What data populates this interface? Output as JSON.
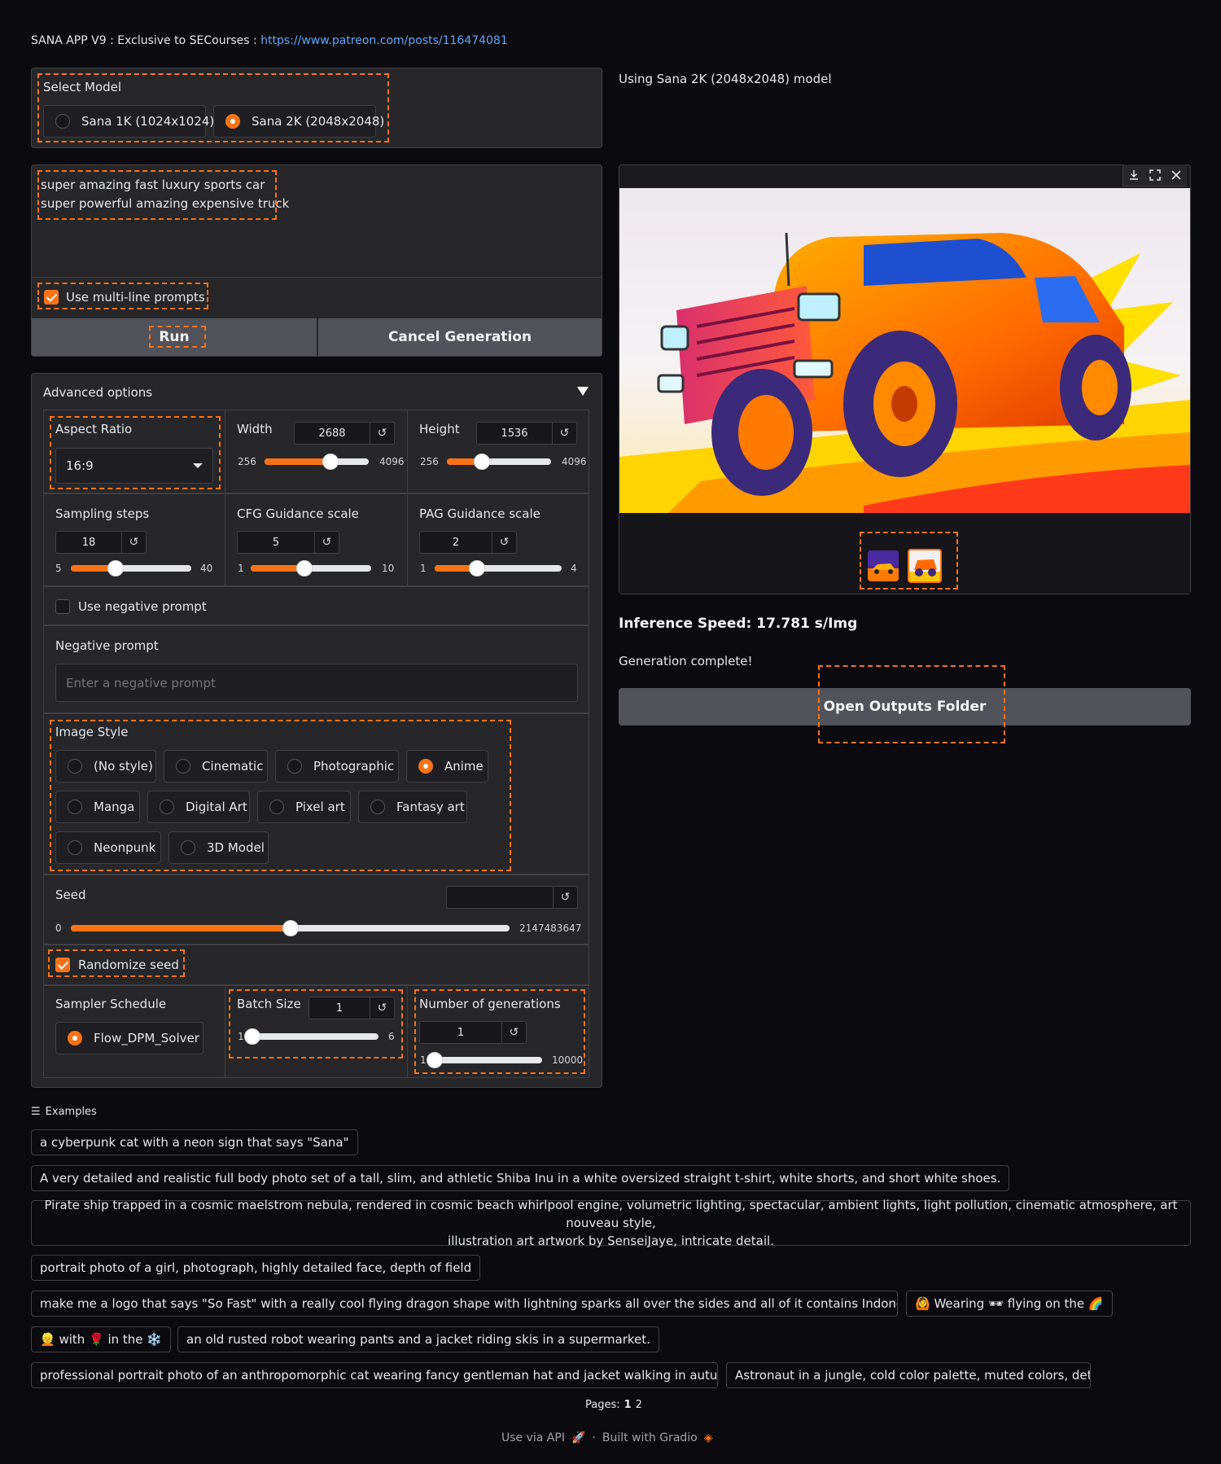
{
  "header": {
    "title": "SANA APP V9 : Exclusive to SECourses : ",
    "link": "https://www.patreon.com/posts/116474081"
  },
  "model_select": {
    "label": "Select Model",
    "options": [
      {
        "label": "Sana 1K (1024x1024)",
        "selected": false
      },
      {
        "label": "Sana 2K (2048x2048)",
        "selected": true
      }
    ],
    "status": "Using Sana 2K (2048x2048) model"
  },
  "prompt": {
    "line1": "super amazing fast luxury sports car",
    "line2": "super powerful amazing expensive truck"
  },
  "multiline": {
    "label": "Use multi-line prompts",
    "checked": true
  },
  "buttons": {
    "run": "Run",
    "cancel": "Cancel Generation",
    "open_outputs": "Open Outputs Folder"
  },
  "advanced": {
    "title": "Advanced options",
    "aspect_ratio": {
      "label": "Aspect Ratio",
      "value": "16:9"
    },
    "width": {
      "label": "Width",
      "value": "2688",
      "min": "256",
      "max": "4096",
      "fraction": 0.636
    },
    "height": {
      "label": "Height",
      "value": "1536",
      "min": "256",
      "max": "4096",
      "fraction": 0.333
    },
    "sampling_steps": {
      "label": "Sampling steps",
      "value": "18",
      "min": "5",
      "max": "40",
      "fraction": 0.371
    },
    "cfg": {
      "label": "CFG Guidance scale",
      "value": "5",
      "min": "1",
      "max": "10",
      "fraction": 0.444
    },
    "pag": {
      "label": "PAG Guidance scale",
      "value": "2",
      "min": "1",
      "max": "4",
      "fraction": 0.333
    },
    "negative_toggle": {
      "label": "Use negative prompt",
      "checked": false
    },
    "negative_prompt": {
      "label": "Negative prompt",
      "placeholder": "Enter a negative prompt"
    },
    "image_style": {
      "label": "Image Style",
      "options": [
        "(No style)",
        "Cinematic",
        "Photographic",
        "Anime",
        "Manga",
        "Digital Art",
        "Pixel art",
        "Fantasy art",
        "Neonpunk",
        "3D Model"
      ],
      "selected": "Anime"
    },
    "seed": {
      "label": "Seed",
      "value": "",
      "min": "0",
      "max": "2147483647",
      "fraction": 0.5
    },
    "randomize": {
      "label": "Randomize seed",
      "checked": true
    },
    "sampler": {
      "label": "Sampler Schedule",
      "option": "Flow_DPM_Solver"
    },
    "batch": {
      "label": "Batch Size",
      "value": "1",
      "min": "1",
      "max": "6",
      "fraction": 0.0
    },
    "generations": {
      "label": "Number of generations",
      "value": "1",
      "min": "1",
      "max": "10000",
      "fraction": 0.0
    }
  },
  "output": {
    "speed": "Inference Speed: 17.781 s/Img",
    "status": "Generation complete!"
  },
  "examples": {
    "header": "Examples",
    "items": [
      "a cyberpunk cat with a neon sign that says \"Sana\"",
      "A very detailed and realistic full body photo set of a tall, slim, and athletic Shiba Inu in a white oversized straight t-shirt, white shorts, and short white shoes.",
      "Pirate ship trapped in a cosmic maelstrom nebula, rendered in cosmic beach whirlpool engine, volumetric lighting, spectacular, ambient lights, light pollution, cinematic atmosphere, art nouveau style,",
      "illustration art artwork by SenseiJaye, intricate detail.",
      "portrait photo of a girl, photograph, highly detailed face, depth of field",
      "make me a logo that says \"So Fast\" with a really cool flying dragon shape with lightning sparks all over the sides and all of it contains Indonesian language",
      "🙆 Wearing 🕶 flying on the 🌈",
      "👱 with 🌹 in the ❄️",
      "an old rusted robot wearing pants and a jacket riding skis in a supermarket.",
      "professional portrait photo of an anthropomorphic cat wearing fancy gentleman hat and jacket walking in autumn forest.",
      "Astronaut in a jungle, cold color palette, muted colors, detailed"
    ],
    "pages_label": "Pages:",
    "pages": [
      "1",
      "2"
    ]
  },
  "footer": {
    "api": "Use via API",
    "built": "Built with Gradio"
  }
}
